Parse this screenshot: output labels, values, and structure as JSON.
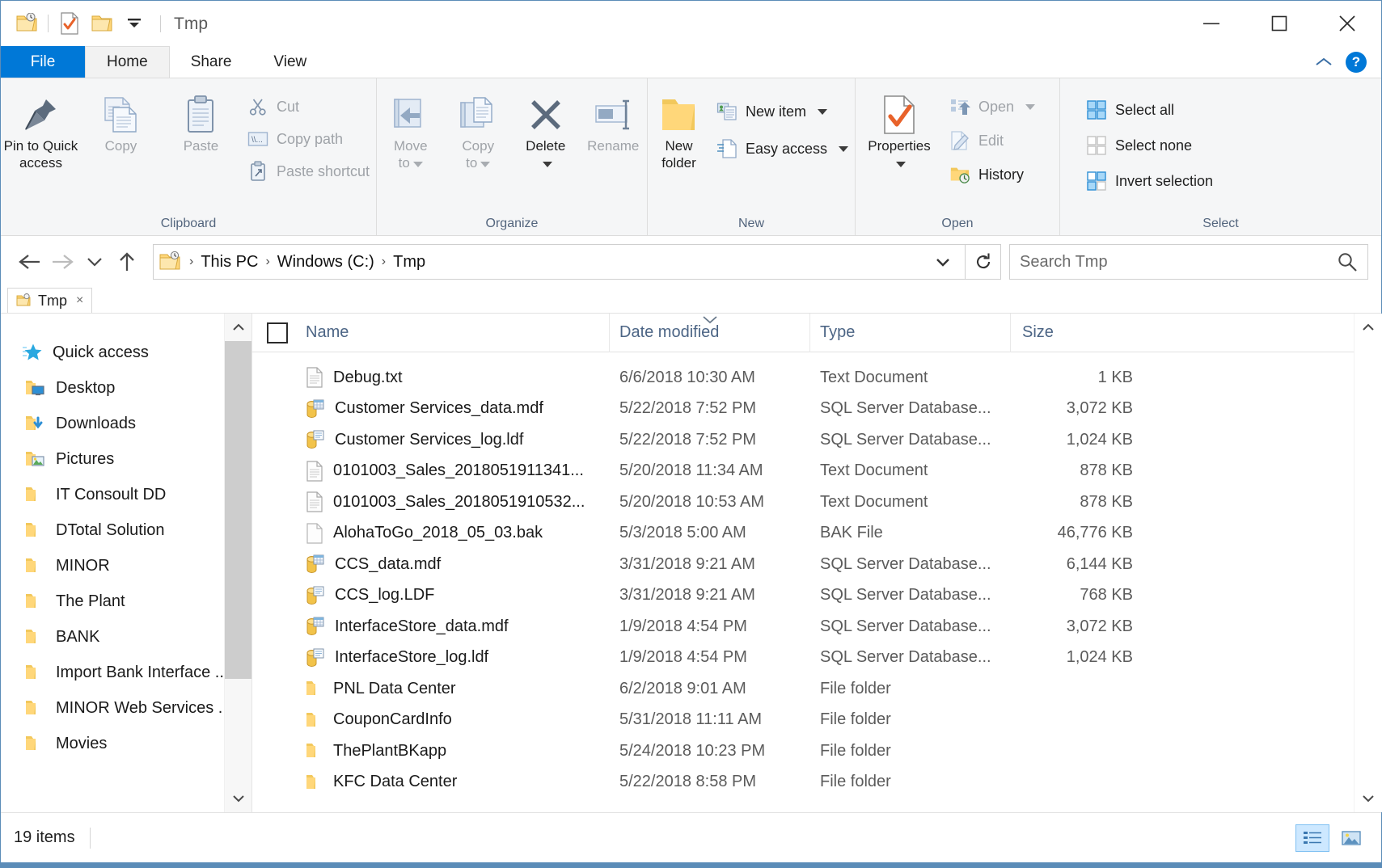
{
  "window": {
    "title": "Tmp",
    "quick_access_toolbar": [
      {
        "name": "properties-history-icon",
        "label": "Properties"
      },
      {
        "name": "new-folder-icon",
        "label": "New folder"
      },
      {
        "name": "customize-qat-icon",
        "label": "Customize Quick Access Toolbar"
      }
    ],
    "controls": {
      "minimize": "—",
      "maximize": "□",
      "close": "✕"
    }
  },
  "ribbon": {
    "tabs": [
      {
        "label": "File",
        "active": false,
        "accent": true
      },
      {
        "label": "Home",
        "active": true,
        "accent": false
      },
      {
        "label": "Share",
        "active": false,
        "accent": false
      },
      {
        "label": "View",
        "active": false,
        "accent": false
      }
    ],
    "collapse_label": "⌃",
    "help_label": "?",
    "groups": [
      {
        "label": "Clipboard",
        "big_buttons": [
          {
            "label": "Pin to Quick\naccess",
            "line1": "Pin to Quick",
            "line2": "access",
            "icon": "pin-icon",
            "dim": false
          },
          {
            "label": "Copy",
            "line1": "Copy",
            "line2": "",
            "icon": "copy-icon",
            "dim": true
          },
          {
            "label": "Paste",
            "line1": "Paste",
            "line2": "",
            "icon": "paste-icon",
            "dim": true
          }
        ],
        "small_buttons": [
          {
            "label": "Cut",
            "icon": "scissors-icon",
            "dim": true
          },
          {
            "label": "Copy path",
            "icon": "copy-path-icon",
            "dim": true
          },
          {
            "label": "Paste shortcut",
            "icon": "paste-shortcut-icon",
            "dim": true
          }
        ]
      },
      {
        "label": "Organize",
        "big_buttons": [
          {
            "line1": "Move",
            "line2": "to",
            "icon": "move-to-icon",
            "dim": true,
            "caret": true
          },
          {
            "line1": "Copy",
            "line2": "to",
            "icon": "copy-to-icon",
            "dim": true,
            "caret": true
          },
          {
            "line1": "Delete",
            "line2": "",
            "icon": "delete-icon",
            "dim": false,
            "caret_below": true
          },
          {
            "line1": "Rename",
            "line2": "",
            "icon": "rename-icon",
            "dim": true
          }
        ],
        "small_buttons": []
      },
      {
        "label": "New",
        "big_buttons": [
          {
            "line1": "New",
            "line2": "folder",
            "icon": "new-folder-icon",
            "dim": false
          }
        ],
        "small_buttons": [
          {
            "label": "New item",
            "icon": "new-item-icon",
            "dim": false,
            "caret": true
          },
          {
            "label": "Easy access",
            "icon": "easy-access-icon",
            "dim": false,
            "caret": true
          }
        ]
      },
      {
        "label": "Open",
        "big_buttons": [
          {
            "line1": "Properties",
            "line2": "",
            "icon": "properties-icon",
            "dim": false,
            "caret_below": true
          }
        ],
        "small_buttons": [
          {
            "label": "Open",
            "icon": "open-icon",
            "dim": true,
            "caret": true
          },
          {
            "label": "Edit",
            "icon": "edit-icon",
            "dim": true
          },
          {
            "label": "History",
            "icon": "history-icon",
            "dim": false
          }
        ]
      },
      {
        "label": "Select",
        "big_buttons": [],
        "small_buttons": [
          {
            "label": "Select all",
            "icon": "select-all-icon",
            "dim": false
          },
          {
            "label": "Select none",
            "icon": "select-none-icon",
            "dim": false
          },
          {
            "label": "Invert selection",
            "icon": "invert-selection-icon",
            "dim": false
          }
        ]
      }
    ]
  },
  "addressbar": {
    "back": "←",
    "forward": "→",
    "recent": "⌄",
    "up": "↑",
    "breadcrumbs": [
      "This PC",
      "Windows (C:)",
      "Tmp"
    ],
    "separator": "›",
    "dropdown": "⌄",
    "refresh": "↻",
    "search_placeholder": "Search Tmp",
    "search_value": "",
    "search_icon": "search-icon"
  },
  "foldertab": {
    "label": "Tmp",
    "close": "×"
  },
  "navpane": {
    "items": [
      {
        "label": "Quick access",
        "icon": "star-icon",
        "pinned": false,
        "root": true
      },
      {
        "label": "Desktop",
        "icon": "folder-desktop-icon",
        "pinned": true,
        "root": false
      },
      {
        "label": "Downloads",
        "icon": "folder-downloads-icon",
        "pinned": true,
        "root": false
      },
      {
        "label": "Pictures",
        "icon": "folder-pictures-icon",
        "pinned": true,
        "root": false
      },
      {
        "label": "IT Consoult DD",
        "icon": "folder-icon",
        "pinned": true,
        "root": false
      },
      {
        "label": "DTotal Solution",
        "icon": "folder-icon",
        "pinned": true,
        "root": false
      },
      {
        "label": "MINOR",
        "icon": "folder-icon",
        "pinned": true,
        "root": false
      },
      {
        "label": "The Plant",
        "icon": "folder-icon",
        "pinned": true,
        "root": false
      },
      {
        "label": "BANK",
        "icon": "folder-icon",
        "pinned": false,
        "root": false
      },
      {
        "label": "Import Bank Interface ...",
        "icon": "folder-icon",
        "pinned": false,
        "root": false
      },
      {
        "label": "MINOR Web Services ...",
        "icon": "folder-icon",
        "pinned": false,
        "root": false
      },
      {
        "label": "Movies",
        "icon": "folder-icon",
        "pinned": false,
        "root": false
      }
    ]
  },
  "filelist": {
    "columns": [
      {
        "key": "name",
        "label": "Name",
        "sorted": false
      },
      {
        "key": "date",
        "label": "Date modified",
        "sorted": true
      },
      {
        "key": "type",
        "label": "Type",
        "sorted": false
      },
      {
        "key": "size",
        "label": "Size",
        "sorted": false
      }
    ],
    "sort_indicator": "⌄",
    "rows": [
      {
        "name": "Debug.txt",
        "date": "6/6/2018 10:30 AM",
        "type": "Text Document",
        "size": "1 KB",
        "icon": "text-file-icon"
      },
      {
        "name": "Customer Services_data.mdf",
        "date": "5/22/2018 7:52 PM",
        "type": "SQL Server Database...",
        "size": "3,072 KB",
        "icon": "mdf-file-icon"
      },
      {
        "name": "Customer Services_log.ldf",
        "date": "5/22/2018 7:52 PM",
        "type": "SQL Server Database...",
        "size": "1,024 KB",
        "icon": "ldf-file-icon"
      },
      {
        "name": "0101003_Sales_2018051911341...",
        "date": "5/20/2018 11:34 AM",
        "type": "Text Document",
        "size": "878 KB",
        "icon": "text-file-icon"
      },
      {
        "name": "0101003_Sales_2018051910532...",
        "date": "5/20/2018 10:53 AM",
        "type": "Text Document",
        "size": "878 KB",
        "icon": "text-file-icon"
      },
      {
        "name": "AlohaToGo_2018_05_03.bak",
        "date": "5/3/2018 5:00 AM",
        "type": "BAK File",
        "size": "46,776 KB",
        "icon": "blank-file-icon"
      },
      {
        "name": "CCS_data.mdf",
        "date": "3/31/2018 9:21 AM",
        "type": "SQL Server Database...",
        "size": "6,144 KB",
        "icon": "mdf-file-icon"
      },
      {
        "name": "CCS_log.LDF",
        "date": "3/31/2018 9:21 AM",
        "type": "SQL Server Database...",
        "size": "768 KB",
        "icon": "ldf-file-icon"
      },
      {
        "name": "InterfaceStore_data.mdf",
        "date": "1/9/2018 4:54 PM",
        "type": "SQL Server Database...",
        "size": "3,072 KB",
        "icon": "mdf-file-icon"
      },
      {
        "name": "InterfaceStore_log.ldf",
        "date": "1/9/2018 4:54 PM",
        "type": "SQL Server Database...",
        "size": "1,024 KB",
        "icon": "ldf-file-icon"
      },
      {
        "name": "PNL Data Center",
        "date": "6/2/2018 9:01 AM",
        "type": "File folder",
        "size": "",
        "icon": "folder-icon"
      },
      {
        "name": "CouponCardInfo",
        "date": "5/31/2018 11:11 AM",
        "type": "File folder",
        "size": "",
        "icon": "folder-icon"
      },
      {
        "name": "ThePlantBKapp",
        "date": "5/24/2018 10:23 PM",
        "type": "File folder",
        "size": "",
        "icon": "folder-icon"
      },
      {
        "name": "KFC Data Center",
        "date": "5/22/2018 8:58 PM",
        "type": "File folder",
        "size": "",
        "icon": "folder-icon"
      }
    ]
  },
  "statusbar": {
    "item_count": "19 items",
    "view_buttons": [
      {
        "name": "details-view-button",
        "label": "Details view",
        "active": true
      },
      {
        "name": "large-icons-view-button",
        "label": "Large icons view",
        "active": false
      }
    ]
  },
  "colors": {
    "accent": "#0078d7",
    "ribbon_bg": "#f5f6f7",
    "group_label": "#53657d",
    "column_header": "#4c6585",
    "folder_yellow": "#ffd77a",
    "window_border": "#5b8cb8"
  }
}
